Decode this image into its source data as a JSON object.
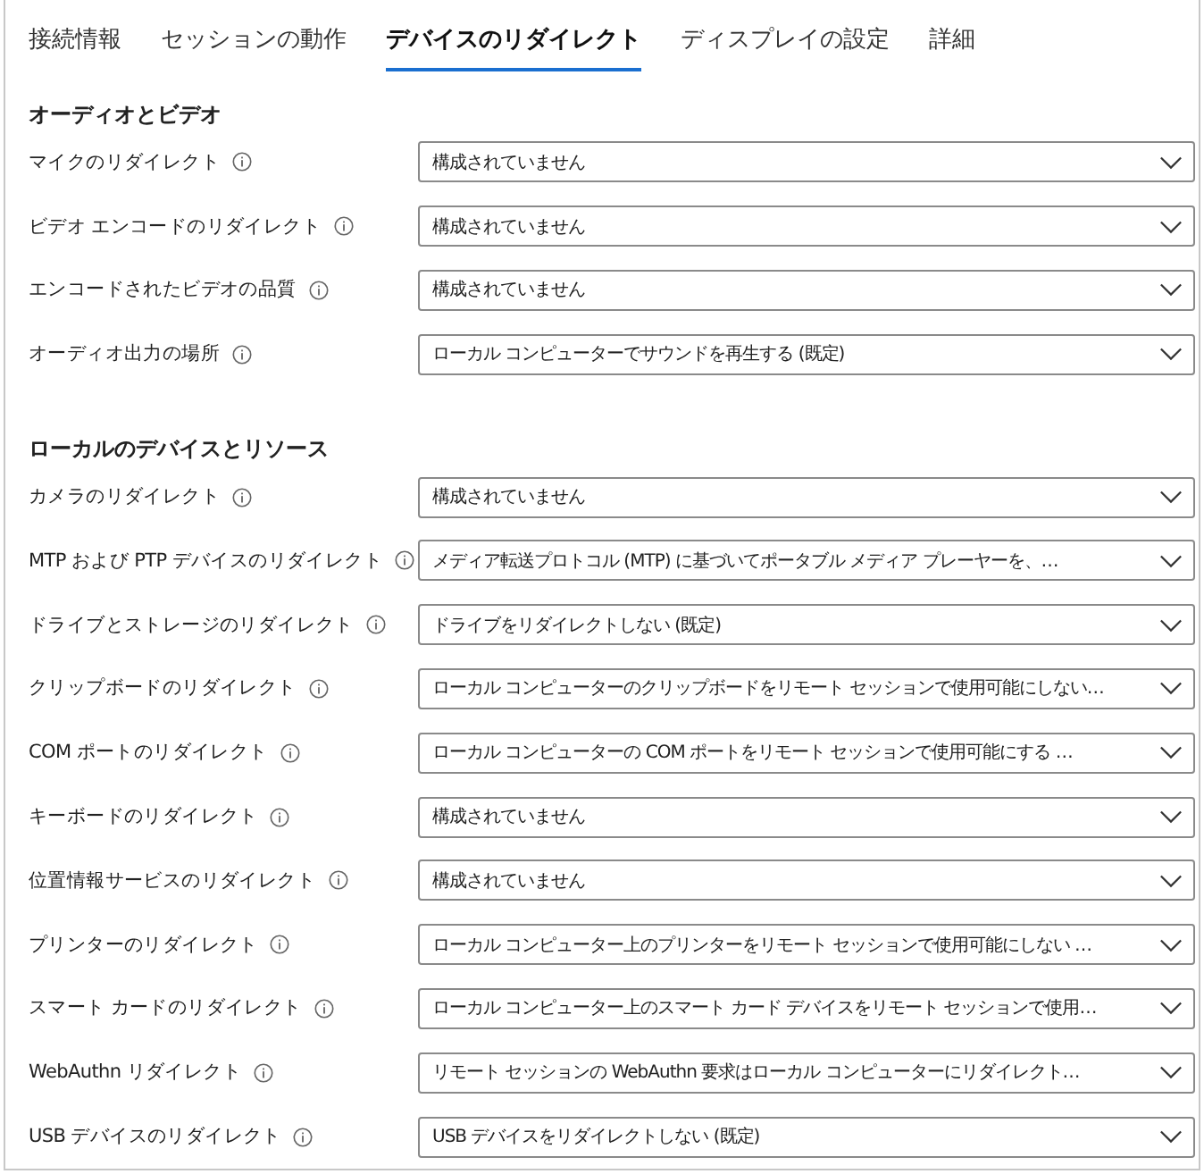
{
  "tabs": [
    {
      "label": "接続情報",
      "selected": false
    },
    {
      "label": "セッションの動作",
      "selected": false
    },
    {
      "label": "デバイスのリダイレクト",
      "selected": true
    },
    {
      "label": "ディスプレイの設定",
      "selected": false
    },
    {
      "label": "詳細",
      "selected": false
    }
  ],
  "sections": [
    {
      "title": "オーディオとビデオ",
      "rows": [
        {
          "label": "マイクのリダイレクト",
          "value": "構成されていません"
        },
        {
          "label": "ビデオ エンコードのリダイレクト",
          "value": "構成されていません"
        },
        {
          "label": "エンコードされたビデオの品質",
          "value": "構成されていません"
        },
        {
          "label": "オーディオ出力の場所",
          "value": "ローカル コンピューターでサウンドを再生する (既定)"
        }
      ]
    },
    {
      "title": "ローカルのデバイスとリソース",
      "rows": [
        {
          "label": "カメラのリダイレクト",
          "value": "構成されていません"
        },
        {
          "label": "MTP および PTP デバイスのリダイレクト",
          "value": "メディア転送プロトコル (MTP) に基づいてポータブル メディア プレーヤーを、…"
        },
        {
          "label": "ドライブとストレージのリダイレクト",
          "value": "ドライブをリダイレクトしない (既定)"
        },
        {
          "label": "クリップボードのリダイレクト",
          "value": "ローカル コンピューターのクリップボードをリモート セッションで使用可能にしない…"
        },
        {
          "label": "COM ポートのリダイレクト",
          "value": "ローカル コンピューターの COM ポートをリモート セッションで使用可能にする …"
        },
        {
          "label": "キーボードのリダイレクト",
          "value": "構成されていません"
        },
        {
          "label": "位置情報サービスのリダイレクト",
          "value": "構成されていません"
        },
        {
          "label": "プリンターのリダイレクト",
          "value": "ローカル コンピューター上のプリンターをリモート セッションで使用可能にしない …"
        },
        {
          "label": "スマート カードのリダイレクト",
          "value": "ローカル コンピューター上のスマート カード デバイスをリモート セッションで使用…"
        },
        {
          "label": "WebAuthn リダイレクト",
          "value": "リモート セッションの WebAuthn 要求はローカル コンピューターにリダイレクト…"
        },
        {
          "label": "USB デバイスのリダイレクト",
          "value": "USB デバイスをリダイレクトしない (既定)"
        }
      ]
    }
  ]
}
